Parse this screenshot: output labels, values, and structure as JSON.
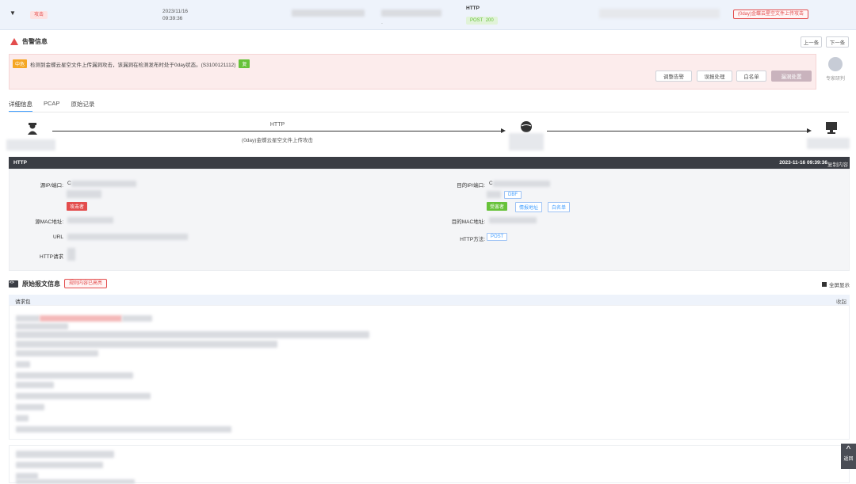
{
  "event_row": {
    "type_tag": "攻击",
    "date": "2023/11/16",
    "time": "09:39:36",
    "dot": ".",
    "protocol": "HTTP",
    "method": "POST",
    "status": "200",
    "attack_name": "(0day)金蝶云星空文件上传攻击"
  },
  "alert": {
    "title": "告警信息",
    "prev_label": "上一条",
    "next_label": "下一条",
    "level": "中危",
    "message": "检测到金蝶云星空文件上传漏洞攻击，该漏洞在检测发布时处于0day状态。(S3100121112)",
    "copy_label": "复",
    "actions": [
      "调整告警",
      "误报处理",
      "白名单",
      "漏洞处置"
    ],
    "expert_label": "专家研判"
  },
  "tabs": [
    "详细信息",
    "PCAP",
    "原始记录"
  ],
  "flow": {
    "protocol": "HTTP",
    "attack_name": "(0day)金蝶云星空文件上传攻击"
  },
  "http": {
    "header_label": "HTTP",
    "timestamp": "2023-11-16 09:39:36",
    "copy_label": "复制内容",
    "src_ip_label": "源IP/端口:",
    "src_ip_prefix": "C",
    "attacker_tag": "攻击者",
    "dst_ip_label": "目的IP/端口:",
    "dst_ip_prefix": "C",
    "dst_sub_tag": "DBF",
    "victim_tag": "受害者",
    "intel_tag": "情报地址",
    "whitelist_tag": "白名单",
    "src_mac_label": "源MAC地址:",
    "dst_mac_label": "目的MAC地址:",
    "url_label": "URL",
    "method_label": "HTTP方法:",
    "method_value": "POST",
    "http_ref_label": "HTTP请求"
  },
  "raw": {
    "title": "原始报文信息",
    "tag": "规则内容已高亮",
    "full_show": "全屏显示",
    "request_label": "请求包",
    "collapse_label": "收起"
  },
  "back_top": "返回"
}
